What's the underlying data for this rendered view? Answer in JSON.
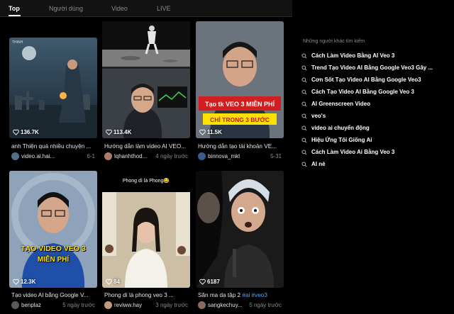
{
  "tabs": [
    {
      "label": "Top",
      "active": true
    },
    {
      "label": "Người dùng",
      "active": false
    },
    {
      "label": "Video",
      "active": false
    },
    {
      "label": "LIVE",
      "active": false
    }
  ],
  "videos": [
    {
      "views": "136.7K",
      "thumb_text": "THINH",
      "caption": "anh Thiện quá nhiều chuyện ...",
      "author": "video.ai.hai...",
      "time": "6-1"
    },
    {
      "views": "113.4K",
      "thumb_text": "",
      "caption": "Hướng dẫn làm video AI VEO...",
      "author": "lqhanhthod...",
      "time": "4 ngày trước"
    },
    {
      "views": "11.5K",
      "thumb_text": "Tạo tk VEO 3 MIỄN PHÍ",
      "thumb_text2": "CHỈ TRONG 3 BƯỚC",
      "caption": "Hướng dẫn tạo tài khoản VE...",
      "author": "binnova_mkt",
      "time": "5-31"
    },
    {
      "views": "12.3K",
      "thumb_text": "TẠO VIDEO VEO 3",
      "thumb_text2": "MIỄN PHÍ",
      "caption": "Tạo video AI bằng Google V...",
      "author": "benplaz",
      "time": "5 ngày trước"
    },
    {
      "views": "84",
      "thumb_text": "Phong dì là Phong😂",
      "caption": "Phong dì là phong veo 3 ...",
      "author": "reviww.hay",
      "time": "3 ngày trước"
    },
    {
      "views": "6187",
      "thumb_text": "",
      "caption": "Săn ma da tập 2 ",
      "caption_tags": "#ai #veo3",
      "author": "sangkechuy...",
      "time": "5 ngày trước"
    }
  ],
  "sidebar": {
    "title": "Những người khác tìm kiếm",
    "suggestions": [
      "Cách Làm Video Bằng AI Veo 3",
      "Trend Tạo Video AI Bằng Google Veo3 Gây ...",
      "Cơn Sốt Tạo Video AI Bằng Google Veo3",
      "Cách Tạo Video AI Bằng Google Veo 3",
      "AI Greenscreen Video",
      "veo's",
      "video ai chuyển động",
      "Hiệu Ứng Tôi Giống Ai",
      "Cách Làm Video Ai Bằng Veo 3",
      "AI nè"
    ]
  },
  "colors": {
    "accent_yellow": "#ffe100",
    "tag_blue": "#5aa5ff",
    "muted": "#8a8a8a"
  }
}
